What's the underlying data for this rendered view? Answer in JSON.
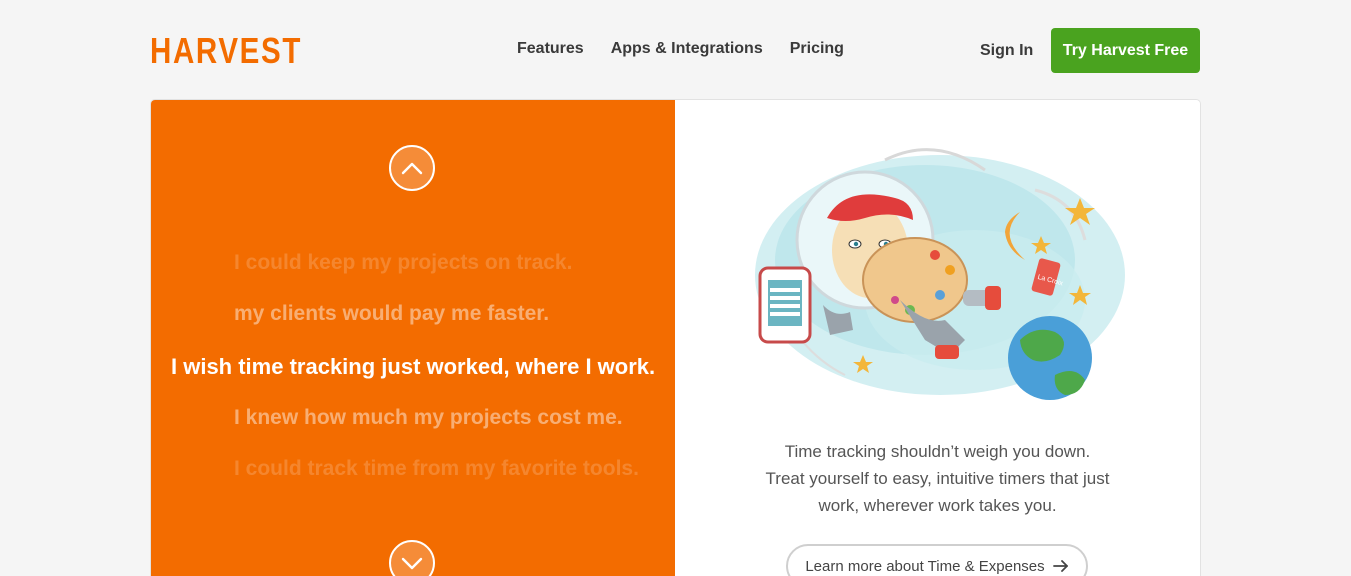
{
  "header": {
    "logo_text": "HARVEST",
    "nav": [
      "Features",
      "Apps & Integrations",
      "Pricing"
    ],
    "sign_in": "Sign In",
    "cta": "Try Harvest Free"
  },
  "hero": {
    "phrases": [
      "I could keep my projects on track.",
      "my clients would pay me faster.",
      "I wish time tracking just worked, where I work.",
      "I knew how much my projects cost me.",
      "I could track time from my favorite tools."
    ],
    "active_phrase_index": 2,
    "description_lines": [
      "Time tracking shouldn’t weigh you down.",
      "Treat yourself to easy, intuitive timers that just",
      "work, wherever work takes you."
    ],
    "learn_more": "Learn more about Time & Expenses",
    "illustration_can_label": "La Croix"
  },
  "icons": {
    "up": "chevron-up-icon",
    "down": "chevron-down-icon",
    "arrow_right": "arrow-right-icon"
  },
  "colors": {
    "brand_orange": "#f36c00",
    "cta_green": "#4aa31f",
    "background": "#f5f5f5"
  }
}
